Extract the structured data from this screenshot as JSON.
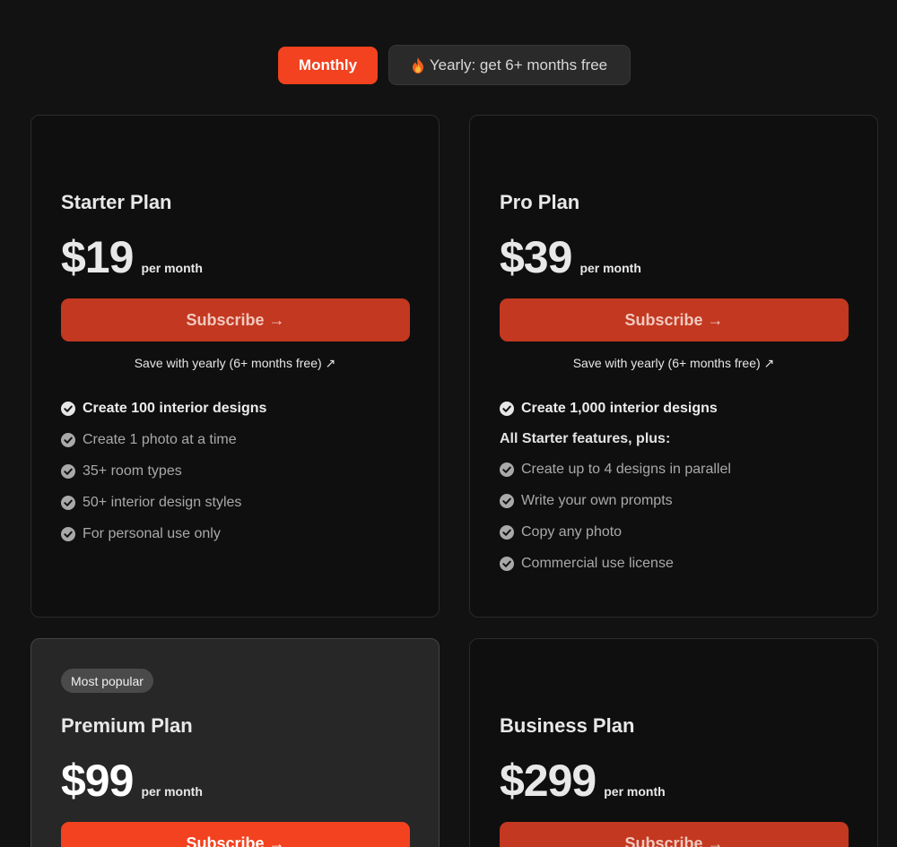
{
  "toggle": {
    "monthly_label": "Monthly",
    "yearly_label": "Yearly: get 6+ months free",
    "selected": "Monthly",
    "accent": "#f2421f"
  },
  "plans": [
    {
      "name": "Starter Plan",
      "price": "$19",
      "period": "per month",
      "cta": "Subscribe →",
      "save_link": "Save with yearly (6+ months free) ↗",
      "features": [
        "Create 100 interior designs",
        "Create 1 photo at a time",
        "35+ room types",
        "50+ interior design styles",
        "For personal use only"
      ]
    },
    {
      "name": "Pro Plan",
      "price": "$39",
      "period": "per month",
      "cta": "Subscribe →",
      "save_link": "Save with yearly (6+ months free) ↗",
      "headline_feature": "Create 1,000 interior designs",
      "subheading": "All Starter features, plus:",
      "features": [
        "Create up to 4 designs in parallel",
        "Write your own prompts",
        "Copy any photo",
        "Commercial use license"
      ]
    },
    {
      "name": "Premium Plan",
      "badge": "Most popular",
      "price": "$99",
      "period": "per month",
      "cta": "Subscribe →"
    },
    {
      "name": "Business Plan",
      "price": "$299",
      "period": "per month",
      "cta": "Subscribe →"
    }
  ]
}
